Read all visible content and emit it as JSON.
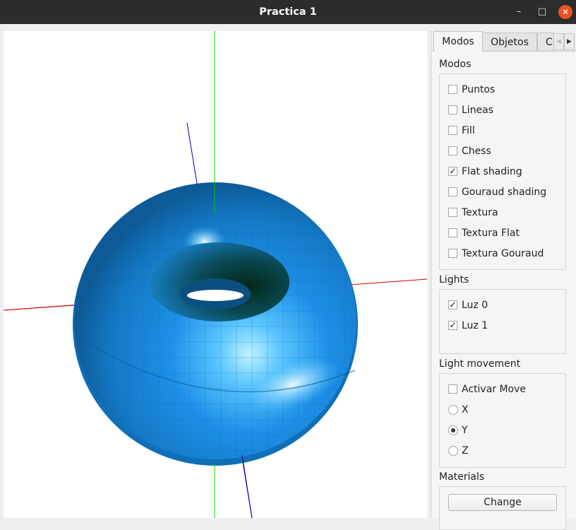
{
  "window": {
    "title": "Practica 1",
    "controls": {
      "minimize": "–",
      "maximize": "□",
      "close": "✕"
    }
  },
  "tabs": [
    {
      "label": "Modos"
    },
    {
      "label": "Objetos"
    },
    {
      "label": "C"
    }
  ],
  "scroll_arrows": {
    "left": "◀",
    "right": "▶"
  },
  "modos": {
    "title": "Modos",
    "items": [
      {
        "label": "Puntos",
        "checked": false
      },
      {
        "label": "Lineas",
        "checked": false
      },
      {
        "label": "Fill",
        "checked": false
      },
      {
        "label": "Chess",
        "checked": false
      },
      {
        "label": "Flat shading",
        "checked": true
      },
      {
        "label": "Gouraud shading",
        "checked": false
      },
      {
        "label": "Textura",
        "checked": false
      },
      {
        "label": "Textura Flat",
        "checked": false
      },
      {
        "label": "Textura Gouraud",
        "checked": false
      }
    ]
  },
  "lights": {
    "title": "Lights",
    "items": [
      {
        "label": "Luz 0",
        "checked": true
      },
      {
        "label": "Luz 1",
        "checked": true
      }
    ]
  },
  "light_movement": {
    "title": "Light movement",
    "activar": {
      "label": "Activar Move",
      "checked": false
    },
    "axes": [
      {
        "label": "X",
        "selected": false
      },
      {
        "label": "Y",
        "selected": true
      },
      {
        "label": "Z",
        "selected": false
      }
    ]
  },
  "materials": {
    "title": "Materials",
    "button": "Change"
  },
  "colors": {
    "torus": "#1e90e8",
    "axis_x": "#cc0000",
    "axis_y": "#00cc00",
    "axis_z": "#0000aa",
    "title_bar": "#2c2c2c",
    "close_button": "#e95420"
  },
  "check_mark": "✓"
}
